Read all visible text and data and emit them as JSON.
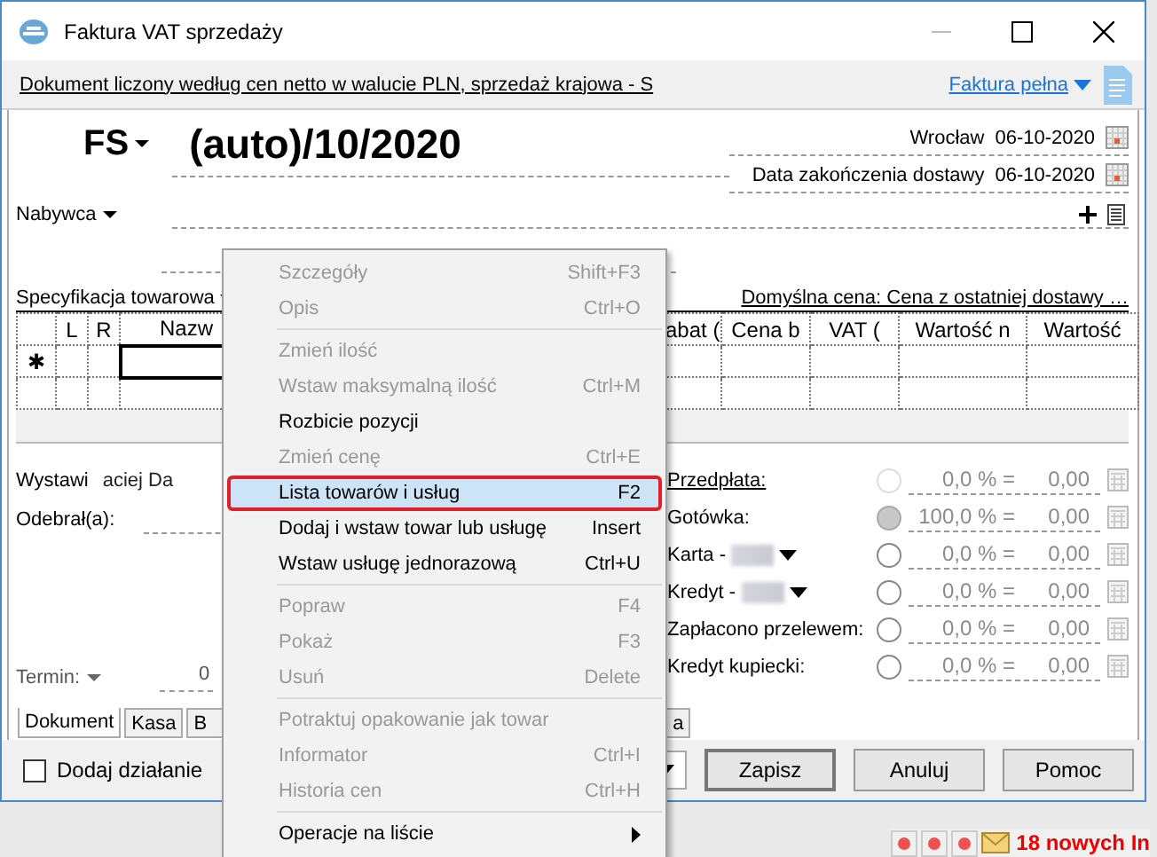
{
  "window": {
    "title": "Faktura VAT sprzedaży"
  },
  "info_bar": {
    "text": "Dokument liczony według cen netto w walucie PLN, sprzedaż krajowa - S",
    "invoice_type": "Faktura pełna"
  },
  "document": {
    "series": "FS",
    "number": "(auto)/10/2020",
    "dates": [
      {
        "label": "Wrocław",
        "value": "06-10-2020"
      },
      {
        "label": "Data zakończenia dostawy",
        "value": "06-10-2020"
      }
    ],
    "buyer_label": "Nabywca"
  },
  "items": {
    "label": "Specyfikacja towarowa",
    "default_price": "Domyślna cena: Cena z ostatniej dostawy …",
    "new_row_marker": "✱",
    "columns": [
      "L",
      "R",
      "Nazw",
      "abat (",
      "Cena b",
      "VAT (",
      "Wartość n",
      "Wartość"
    ]
  },
  "issuer": {
    "label": "Wystawi",
    "value": "aciej Da"
  },
  "receiver": {
    "label": "Odebrał(a):"
  },
  "term": {
    "label": "Termin:",
    "value": "0"
  },
  "payments": [
    {
      "label": "Przedpłata:",
      "underlined": true,
      "disabled": true,
      "selected": false,
      "redacted": false,
      "dropdown": false,
      "percent": "0,0 % =",
      "amount": "0,00"
    },
    {
      "label": "Gotówka:",
      "underlined": false,
      "disabled": false,
      "selected": true,
      "redacted": false,
      "dropdown": false,
      "percent": "100,0 % =",
      "amount": "0,00"
    },
    {
      "label": "Karta -",
      "underlined": false,
      "disabled": false,
      "selected": false,
      "redacted": true,
      "dropdown": true,
      "percent": "0,0 % =",
      "amount": "0,00"
    },
    {
      "label": "Kredyt -",
      "underlined": false,
      "disabled": false,
      "selected": false,
      "redacted": true,
      "dropdown": true,
      "percent": "0,0 % =",
      "amount": "0,00"
    },
    {
      "label": "Zapłacono przelewem:",
      "underlined": false,
      "disabled": false,
      "selected": false,
      "redacted": false,
      "dropdown": false,
      "percent": "0,0 % =",
      "amount": "0,00"
    },
    {
      "label": "Kredyt kupiecki:",
      "underlined": false,
      "disabled": false,
      "selected": false,
      "redacted": false,
      "dropdown": false,
      "percent": "0,0 % =",
      "amount": "0,00"
    }
  ],
  "tabs": [
    {
      "label": "Dokument",
      "selected": true
    },
    {
      "label": "Kasa",
      "selected": false
    },
    {
      "label": "B",
      "selected": false
    },
    {
      "label": "a",
      "selected": false
    }
  ],
  "footer": {
    "add_action": {
      "label": "Dodaj działanie",
      "checked": false
    },
    "buttons": [
      "Zapisz",
      "Anuluj",
      "Pomoc"
    ]
  },
  "status": {
    "notifications": "18 nowych In"
  },
  "context_menu": [
    {
      "kind": "item",
      "label": "Szczegóły",
      "shortcut": "Shift+F3",
      "disabled": true,
      "selected": false
    },
    {
      "kind": "item",
      "label": "Opis",
      "shortcut": "Ctrl+O",
      "disabled": true,
      "selected": false
    },
    {
      "kind": "separator"
    },
    {
      "kind": "item",
      "label": "Zmień ilość",
      "disabled": true,
      "selected": false
    },
    {
      "kind": "item",
      "label": "Wstaw maksymalną ilość",
      "shortcut": "Ctrl+M",
      "disabled": true,
      "selected": false
    },
    {
      "kind": "item",
      "label": "Rozbicie pozycji",
      "disabled": false,
      "selected": false
    },
    {
      "kind": "item",
      "label": "Zmień cenę",
      "shortcut": "Ctrl+E",
      "disabled": true,
      "selected": false
    },
    {
      "kind": "item",
      "label": "Lista towarów i usług",
      "shortcut": "F2",
      "disabled": false,
      "selected": true
    },
    {
      "kind": "item",
      "label": "Dodaj i wstaw towar lub usługę",
      "shortcut": "Insert",
      "disabled": false,
      "selected": false
    },
    {
      "kind": "item",
      "label": "Wstaw usługę jednorazową",
      "shortcut": "Ctrl+U",
      "disabled": false,
      "selected": false
    },
    {
      "kind": "separator"
    },
    {
      "kind": "item",
      "label": "Popraw",
      "shortcut": "F4",
      "disabled": true,
      "selected": false
    },
    {
      "kind": "item",
      "label": "Pokaż",
      "shortcut": "F3",
      "disabled": true,
      "selected": false
    },
    {
      "kind": "item",
      "label": "Usuń",
      "shortcut": "Delete",
      "disabled": true,
      "selected": false
    },
    {
      "kind": "separator"
    },
    {
      "kind": "item",
      "label": "Potraktuj opakowanie jak towar",
      "disabled": true,
      "selected": false
    },
    {
      "kind": "item",
      "label": "Informator",
      "shortcut": "Ctrl+I",
      "disabled": true,
      "selected": false
    },
    {
      "kind": "item",
      "label": "Historia cen",
      "shortcut": "Ctrl+H",
      "disabled": true,
      "selected": false
    },
    {
      "kind": "separator"
    },
    {
      "kind": "submenu",
      "label": "Operacje na liście",
      "disabled": false,
      "selected": false
    }
  ]
}
